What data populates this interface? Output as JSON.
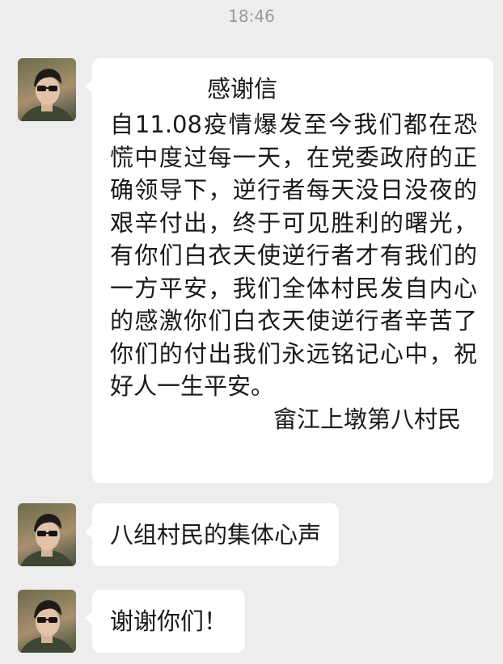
{
  "timestamp": "18:46",
  "messages": [
    {
      "sender_avatar": "avatar-photo",
      "title": "感谢信",
      "body": "自11.08疫情爆发至今我们都在恐慌中度过每一天，在党委政府的正确领导下，逆行者每天没日没夜的艰辛付出，终于可见胜利的曙光，有你们白衣天使逆行者才有我们的一方平安，我们全体村民发自内心的感激你们白衣天使逆行者辛苦了你们的付出我们永远铭记心中，祝好人一生平安。",
      "signature": "畲江上墩第八村民"
    },
    {
      "sender_avatar": "avatar-photo",
      "text": "八组村民的集体心声"
    },
    {
      "sender_avatar": "avatar-photo",
      "text": "谢谢你们！"
    }
  ],
  "colors": {
    "background": "#ededed",
    "bubble": "#ffffff",
    "timestamp_text": "#9a9a9a",
    "message_text": "#191919"
  }
}
